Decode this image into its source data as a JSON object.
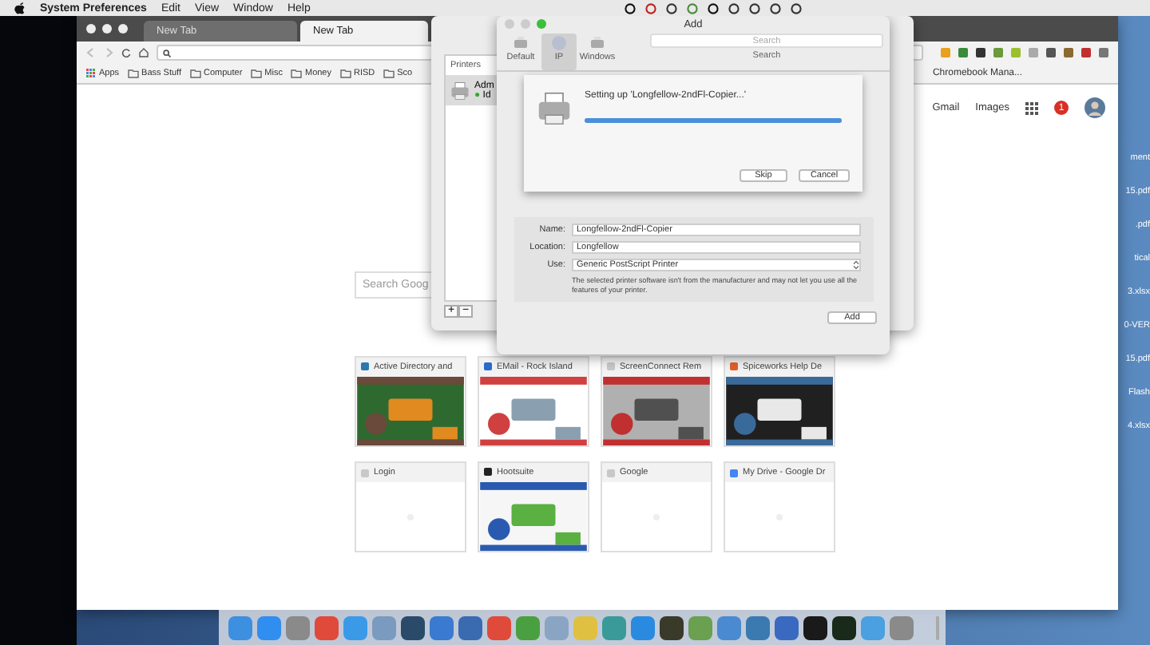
{
  "menu_bar": {
    "app": "System Preferences",
    "menus": [
      "Edit",
      "View",
      "Window",
      "Help"
    ]
  },
  "desktop_files": [
    "ment",
    "15.pdf",
    ".pdf",
    "tical",
    "3.xlsx",
    "0-VER",
    "15.pdf",
    "Flash",
    "4.xlsx"
  ],
  "browser": {
    "tabs": [
      {
        "label": "New Tab",
        "selected": false
      },
      {
        "label": "New Tab",
        "selected": true
      }
    ],
    "bookmarks": [
      {
        "label": "Apps",
        "kind": "apps"
      },
      {
        "label": "Bass Stuff",
        "kind": "folder"
      },
      {
        "label": "Computer",
        "kind": "folder"
      },
      {
        "label": "Misc",
        "kind": "folder"
      },
      {
        "label": "Money",
        "kind": "folder"
      },
      {
        "label": "RISD",
        "kind": "folder"
      },
      {
        "label": "Sco",
        "kind": "folder"
      }
    ],
    "bookmark_overflow": "Chromebook Mana...",
    "header_links": [
      "Gmail",
      "Images"
    ],
    "notification_count": "1",
    "search": {
      "placeholder": "Search Goog"
    },
    "tiles": [
      {
        "title": "Active Directory and",
        "color": "#2a7ab0",
        "kind": "picture"
      },
      {
        "title": "EMail - Rock Island",
        "color": "#2a6ac8",
        "kind": "picture"
      },
      {
        "title": "ScreenConnect Rem",
        "color": "#c8c8c8",
        "kind": "picture"
      },
      {
        "title": "Spiceworks Help De",
        "color": "#e0602a",
        "kind": "picture"
      },
      {
        "title": "Login",
        "color": "#c8c8c8",
        "kind": "blank"
      },
      {
        "title": "Hootsuite",
        "color": "#222222",
        "kind": "picture"
      },
      {
        "title": "Google",
        "color": "#c8c8c8",
        "kind": "blank"
      },
      {
        "title": "My Drive - Google Dr",
        "color": "#4285f4",
        "kind": "blank"
      }
    ]
  },
  "printers_window": {
    "tab": "Printers",
    "printer": {
      "name": "Adm",
      "dot": "●",
      "status": "Id"
    },
    "buttons": [
      "+",
      "−"
    ]
  },
  "add_dialog": {
    "title": "Add",
    "toolbar": [
      {
        "label": "Default",
        "selected": false
      },
      {
        "label": "IP",
        "selected": true
      },
      {
        "label": "Windows",
        "selected": false
      }
    ],
    "search": {
      "placeholder": "Search",
      "label": "Search"
    },
    "progress": {
      "message": "Setting up 'Longfellow-2ndFl-Copier...'",
      "level": 1,
      "buttons": [
        "Skip",
        "Cancel"
      ]
    },
    "form": [
      {
        "label": "Name:",
        "value": "Longfellow-2ndFl-Copier",
        "kind": "text"
      },
      {
        "label": "Location:",
        "value": "Longfellow",
        "kind": "text"
      },
      {
        "label": "Use:",
        "value": "Generic PostScript Printer",
        "kind": "select"
      }
    ],
    "note": "The selected printer software isn't from the manufacturer and may not let you use all the features of your printer.",
    "add_button": "Add"
  },
  "dock": [
    {
      "color": "#3d8fe0"
    },
    {
      "color": "#2f8ef0"
    },
    {
      "color": "#8a8a8a"
    },
    {
      "color": "#e04a3a"
    },
    {
      "color": "#3a9ae8"
    },
    {
      "color": "#7a9ac0"
    },
    {
      "color": "#2a4a6a"
    },
    {
      "color": "#3a7ad0"
    },
    {
      "color": "#3a6ab0"
    },
    {
      "color": "#e04a3a"
    },
    {
      "color": "#4aa040"
    },
    {
      "color": "#8aa4c4"
    },
    {
      "color": "#e0c040"
    },
    {
      "color": "#3a9a9a"
    },
    {
      "color": "#2a8ae0"
    },
    {
      "color": "#3a3a2a"
    },
    {
      "color": "#6aa050"
    },
    {
      "color": "#4a8ad0"
    },
    {
      "color": "#3a7ab0"
    },
    {
      "color": "#3a6ac0"
    },
    {
      "color": "#1a1a1a"
    },
    {
      "color": "#1a2a1a"
    },
    {
      "color": "#4aa0e0"
    },
    {
      "color": "#8a8a8a"
    }
  ]
}
